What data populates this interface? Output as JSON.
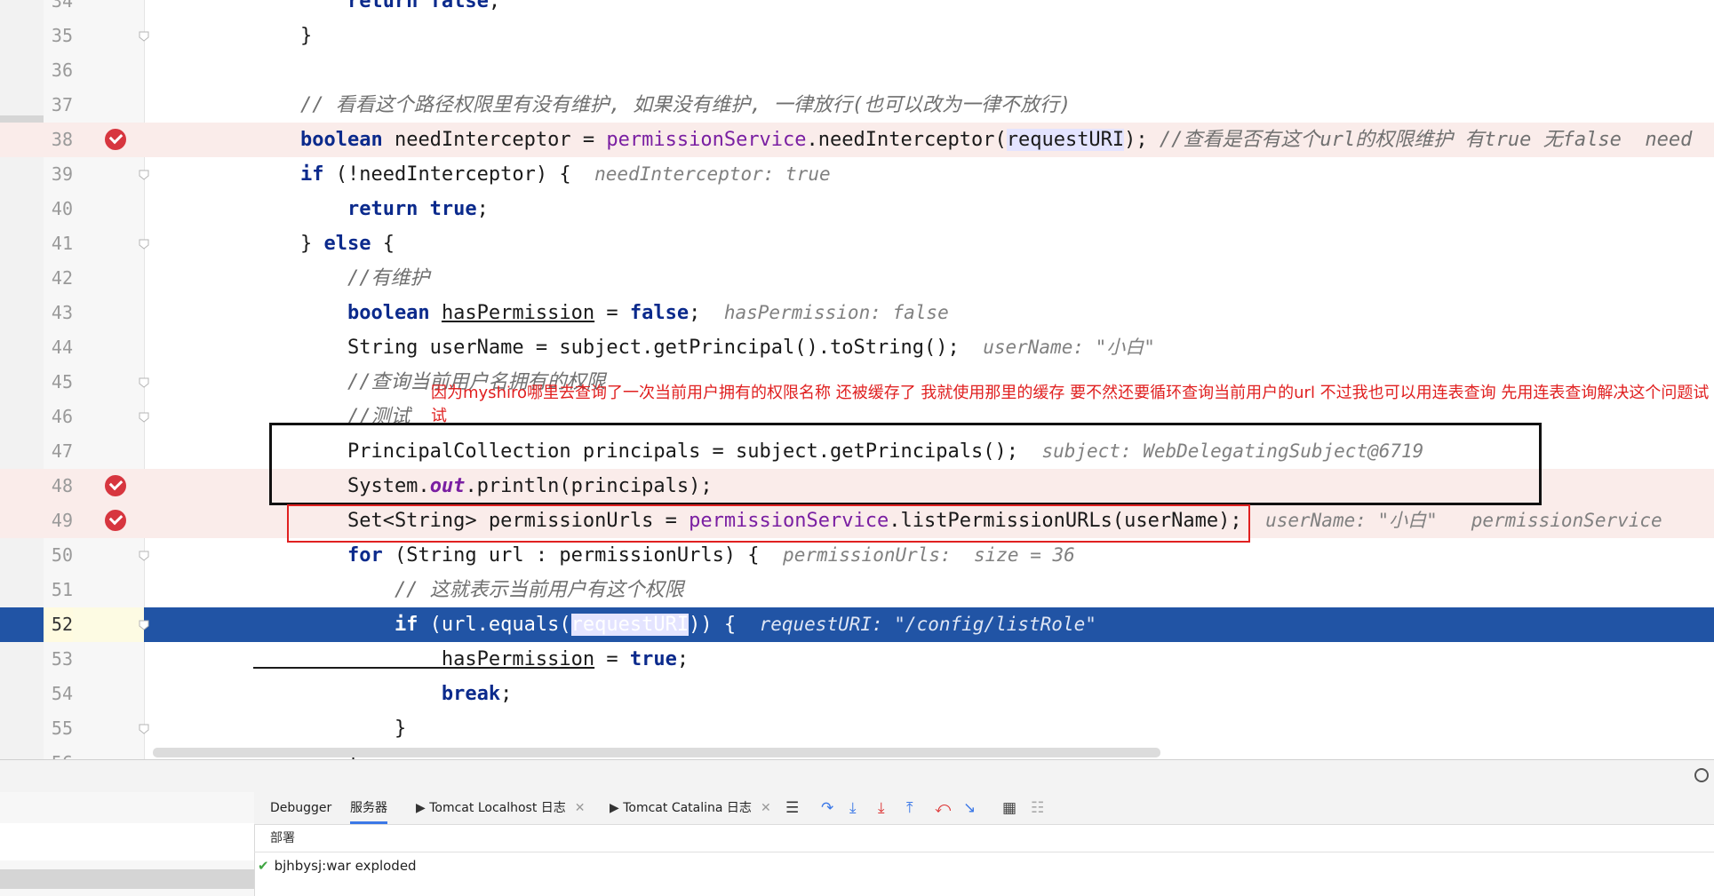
{
  "editor": {
    "lines": [
      {
        "no": "34",
        "parts": [
          [
            "kw",
            "        return false"
          ],
          [
            "p",
            ";"
          ]
        ]
      },
      {
        "no": "35",
        "parts": [
          [
            "p",
            "    }"
          ]
        ]
      },
      {
        "no": "36",
        "parts": []
      },
      {
        "no": "37",
        "parts": [
          [
            "cmt",
            "    // 看看这个路径权限里有没有维护, 如果没有维护, 一律放行(也可以改为一律不放行)"
          ]
        ]
      },
      {
        "no": "38",
        "parts": [
          [
            "kw",
            "    boolean"
          ],
          [
            "p",
            " needInterceptor = "
          ],
          [
            "mth",
            "permissionService"
          ],
          [
            "p",
            ".needInterceptor("
          ],
          [
            "hl",
            "requestURI"
          ],
          [
            "p",
            "); "
          ],
          [
            "cmt",
            "//查看是否有这个url的权限维护 有true 无false  need"
          ]
        ]
      },
      {
        "no": "39",
        "parts": [
          [
            "kw",
            "    if"
          ],
          [
            "p",
            " (!needInterceptor) {  "
          ],
          [
            "hint",
            "needInterceptor: true"
          ]
        ]
      },
      {
        "no": "40",
        "parts": [
          [
            "kw",
            "        return true"
          ],
          [
            "p",
            ";"
          ]
        ]
      },
      {
        "no": "41",
        "parts": [
          [
            "p",
            "    } "
          ],
          [
            "kw",
            "else"
          ],
          [
            "p",
            " {"
          ]
        ]
      },
      {
        "no": "42",
        "parts": [
          [
            "cmt",
            "        //有维护"
          ]
        ]
      },
      {
        "no": "43",
        "parts": [
          [
            "kw",
            "        boolean"
          ],
          [
            "p",
            " "
          ],
          [
            "ul",
            "hasPermission"
          ],
          [
            "p",
            " = "
          ],
          [
            "kw",
            "false"
          ],
          [
            "p",
            ";  "
          ],
          [
            "hint",
            "hasPermission: false"
          ]
        ]
      },
      {
        "no": "44",
        "parts": [
          [
            "p",
            "        String userName = subject.getPrincipal().toString();  "
          ],
          [
            "hint",
            "userName: \"小白\""
          ]
        ]
      },
      {
        "no": "45",
        "parts": [
          [
            "cmt",
            "        //查询当前用户名拥有的权限"
          ]
        ]
      },
      {
        "no": "46",
        "parts": [
          [
            "cmt",
            "        //测试"
          ]
        ]
      },
      {
        "no": "47",
        "parts": [
          [
            "p",
            "        PrincipalCollection principals = subject.getPrincipals();  "
          ],
          [
            "hint",
            "subject: WebDelegatingSubject@6719"
          ]
        ]
      },
      {
        "no": "48",
        "parts": [
          [
            "p",
            "        System."
          ],
          [
            "stat",
            "out"
          ],
          [
            "p",
            ".println(principals);"
          ]
        ]
      },
      {
        "no": "49",
        "parts": [
          [
            "p",
            "        Set<String> permissionUrls = "
          ],
          [
            "mth",
            "permissionService"
          ],
          [
            "p",
            ".listPermissionURLs(userName);  "
          ],
          [
            "hint",
            "userName: \"小白\"   permissionService"
          ]
        ]
      },
      {
        "no": "50",
        "parts": [
          [
            "kw",
            "        for"
          ],
          [
            "p",
            " (String url : permissionUrls) {  "
          ],
          [
            "hint",
            "permissionUrls:  size = 36"
          ]
        ]
      },
      {
        "no": "51",
        "parts": [
          [
            "cmt",
            "            // 这就表示当前用户有这个权限"
          ]
        ]
      },
      {
        "no": "52",
        "parts": [
          [
            "kw",
            "            if"
          ],
          [
            "p",
            " (url.equals("
          ],
          [
            "hl",
            "requestURI"
          ],
          [
            "p",
            ")) {  "
          ],
          [
            "hint",
            "requestURI: \"/config/listRole\""
          ]
        ]
      },
      {
        "no": "53",
        "parts": [
          [
            "ul",
            "                hasPermission"
          ],
          [
            "p",
            " = "
          ],
          [
            "kw",
            "true"
          ],
          [
            "p",
            ";"
          ]
        ]
      },
      {
        "no": "54",
        "parts": [
          [
            "kw",
            "                break"
          ],
          [
            "p",
            ";"
          ]
        ]
      },
      {
        "no": "55",
        "parts": [
          [
            "p",
            "            }"
          ]
        ]
      },
      {
        "no": "56",
        "parts": [
          [
            "p",
            "        }"
          ]
        ]
      }
    ]
  },
  "annotation": {
    "text": "因为myshiro哪里去查询了一次当前用户拥有的权限名称  还被缓存了  我就使用那里的缓存   要不然还要循环查询当前用户的url    不过我也可以用连表查询  先用连表查询解决这个问题试试"
  },
  "debug_panel": {
    "tabs": {
      "debugger": "Debugger",
      "server": "服务器",
      "tomcat_localhost": "Tomcat Localhost 日志",
      "tomcat_catalina": "Tomcat Catalina 日志"
    },
    "deploy_header": "部署",
    "artifact": "bjhbysj:war exploded"
  },
  "colors": {
    "breakpoint_row": "#faecea",
    "current_line": "#2154a5",
    "annotation": "#e02020"
  }
}
